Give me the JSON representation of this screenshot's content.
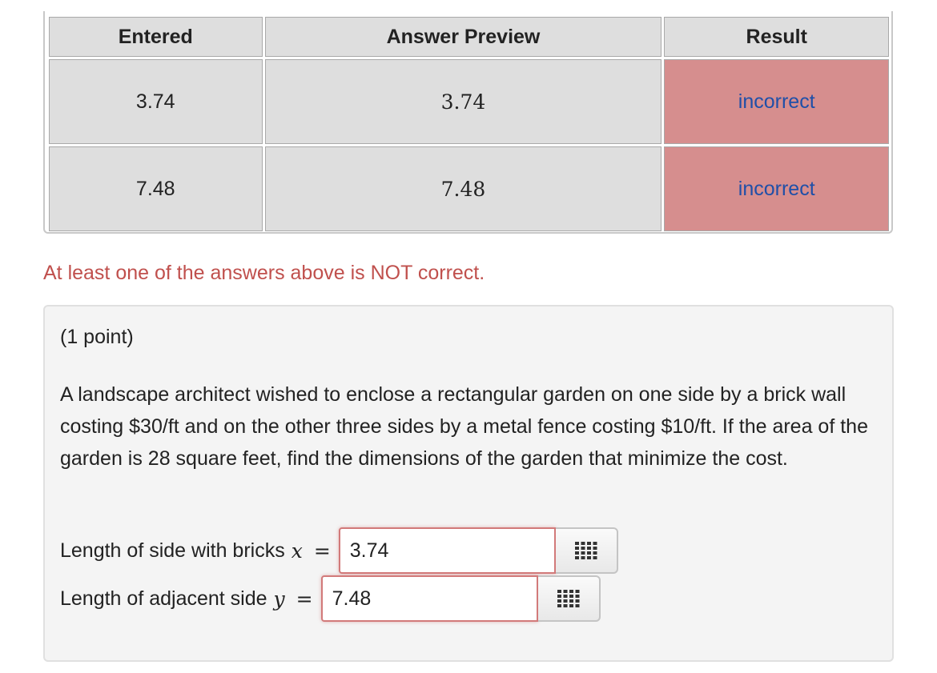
{
  "results_table": {
    "headers": [
      "Entered",
      "Answer Preview",
      "Result"
    ],
    "rows": [
      {
        "entered": "3.74",
        "preview": "3.74",
        "result": "incorrect"
      },
      {
        "entered": "7.48",
        "preview": "7.48",
        "result": "incorrect"
      }
    ]
  },
  "warning": "At least one of the answers above is NOT correct.",
  "problem": {
    "points": "(1 point)",
    "text": "A landscape architect wished to enclose a rectangular garden on one side by a brick wall costing $30/ft and on the other three sides by a metal fence costing $10/ft. If the area of the garden is 28 square feet, find the dimensions of the garden that minimize the cost.",
    "answers": [
      {
        "label": "Length of side with bricks",
        "variable": "x",
        "equals": "=",
        "value": "3.74",
        "palette_icon": "grid-keypad-icon"
      },
      {
        "label": "Length of adjacent side",
        "variable": "y",
        "equals": "=",
        "value": "7.48",
        "palette_icon": "grid-keypad-icon"
      }
    ]
  },
  "colors": {
    "incorrect_bg": "#d68e8e",
    "incorrect_text": "#1f4fa8",
    "warning_text": "#c0504d",
    "input_error_border": "#d27a7a"
  }
}
